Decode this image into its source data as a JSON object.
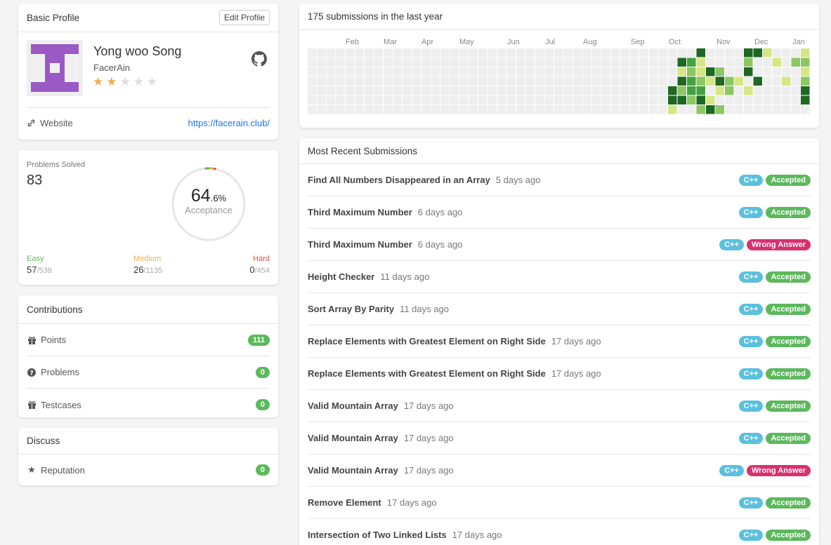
{
  "profile": {
    "title": "Basic Profile",
    "edit_label": "Edit Profile",
    "name": "Yong woo Song",
    "username": "FacerAin",
    "rating": 2,
    "max_rating": 5,
    "website_label": "Website",
    "website_url": "https://facerain.club/",
    "avatar_color": "#9b59c6"
  },
  "solved": {
    "label": "Problems Solved",
    "count": "83",
    "acceptance_int": "64",
    "acceptance_dec": ".6%",
    "acceptance_label": "Acceptance",
    "easy_label": "Easy",
    "easy_solved": "57",
    "easy_total": "/538",
    "medium_label": "Medium",
    "medium_solved": "26",
    "medium_total": "/1135",
    "hard_label": "Hard",
    "hard_solved": "0",
    "hard_total": "/454",
    "colors": {
      "easy": "#5cb85c",
      "medium": "#f0ad4e",
      "hard": "#d9534f"
    }
  },
  "contributions": {
    "title": "Contributions",
    "items": [
      {
        "icon": "gift-icon",
        "label": "Points",
        "value": "111"
      },
      {
        "icon": "question-circle-icon",
        "label": "Problems",
        "value": "0"
      },
      {
        "icon": "gift-icon",
        "label": "Testcases",
        "value": "0"
      }
    ]
  },
  "discuss": {
    "title": "Discuss",
    "items": [
      {
        "icon": "star-icon",
        "label": "Reputation",
        "value": "0"
      }
    ]
  },
  "calendar": {
    "title": "175 submissions in the last year",
    "months": [
      "Feb",
      "Mar",
      "Apr",
      "May",
      "Jun",
      "Jul",
      "Aug",
      "Sep",
      "Oct",
      "Nov",
      "Dec",
      "Jan"
    ],
    "colors": {
      "empty": "#eeeeee",
      "l1": "#d6e685",
      "l2": "#8cc665",
      "l3": "#44a340",
      "l4": "#1e6823"
    }
  },
  "submissions": {
    "title": "Most Recent Submissions",
    "items": [
      {
        "title": "Find All Numbers Disappeared in an Array",
        "time": "5 days ago",
        "lang": "C++",
        "status": "Accepted"
      },
      {
        "title": "Third Maximum Number",
        "time": "6 days ago",
        "lang": "C++",
        "status": "Accepted"
      },
      {
        "title": "Third Maximum Number",
        "time": "6 days ago",
        "lang": "C++",
        "status": "Wrong Answer"
      },
      {
        "title": "Height Checker",
        "time": "11 days ago",
        "lang": "C++",
        "status": "Accepted"
      },
      {
        "title": "Sort Array By Parity",
        "time": "11 days ago",
        "lang": "C++",
        "status": "Accepted"
      },
      {
        "title": "Replace Elements with Greatest Element on Right Side",
        "time": "17 days ago",
        "lang": "C++",
        "status": "Accepted"
      },
      {
        "title": "Replace Elements with Greatest Element on Right Side",
        "time": "17 days ago",
        "lang": "C++",
        "status": "Accepted"
      },
      {
        "title": "Valid Mountain Array",
        "time": "17 days ago",
        "lang": "C++",
        "status": "Accepted"
      },
      {
        "title": "Valid Mountain Array",
        "time": "17 days ago",
        "lang": "C++",
        "status": "Accepted"
      },
      {
        "title": "Valid Mountain Array",
        "time": "17 days ago",
        "lang": "C++",
        "status": "Wrong Answer"
      },
      {
        "title": "Remove Element",
        "time": "17 days ago",
        "lang": "C++",
        "status": "Accepted"
      },
      {
        "title": "Intersection of Two Linked Lists",
        "time": "17 days ago",
        "lang": "C++",
        "status": "Accepted"
      }
    ]
  }
}
